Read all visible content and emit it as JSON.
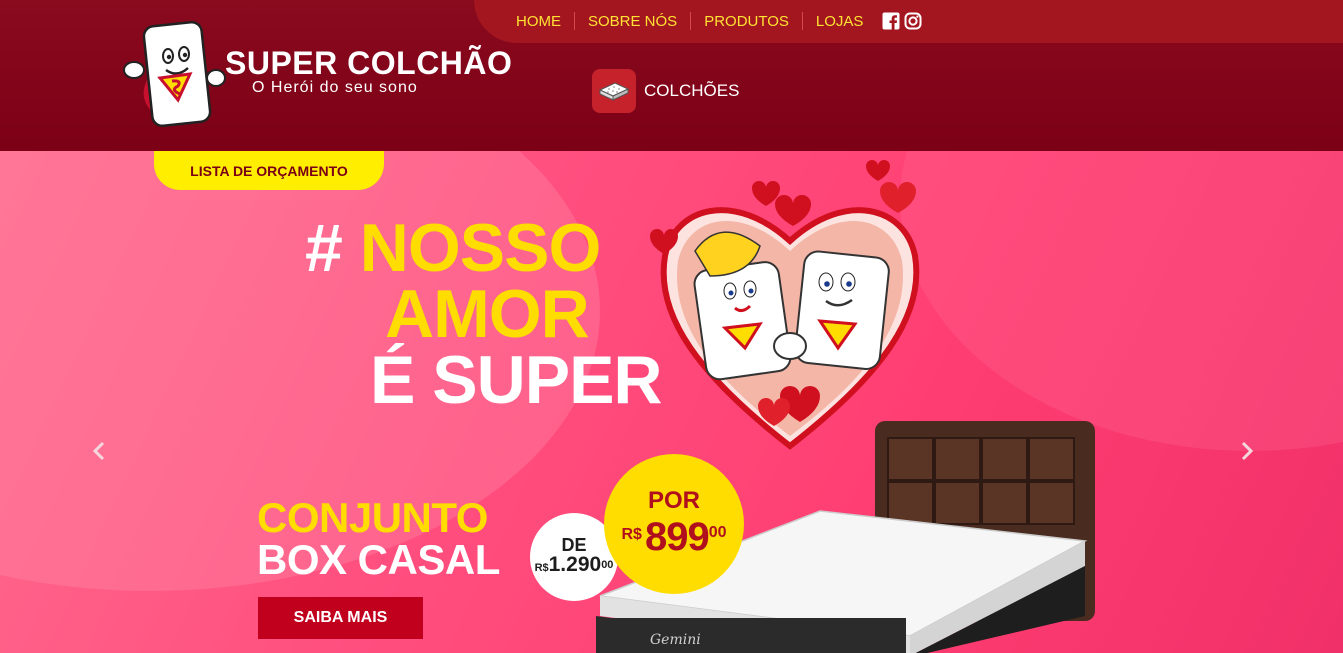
{
  "brand": {
    "name": "SUPER COLCHÃO",
    "tagline": "O Herói do seu sono"
  },
  "nav": {
    "items": [
      "HOME",
      "SOBRE NÓS",
      "PRODUTOS",
      "LOJAS"
    ],
    "social": [
      "facebook-icon",
      "instagram-icon"
    ]
  },
  "categories": [
    {
      "label": "COLCHÕES",
      "icon": "mattress-icon"
    }
  ],
  "banner": {
    "budget_tab": "LISTA DE ORÇAMENTO",
    "headline": {
      "hash": "#",
      "line1": "NOSSO",
      "line2": "AMOR",
      "line3": "É SUPER"
    },
    "product_line1": "CONJUNTO",
    "product_line2": "BOX CASAL",
    "old_price": {
      "prefix": "DE",
      "currency": "R$",
      "value": "1.290",
      "cents": "00"
    },
    "new_price": {
      "prefix": "POR",
      "currency": "R$",
      "value": "899",
      "cents": "00"
    },
    "cta": "SAIBA MAIS",
    "mattress_brand": "Gemini"
  },
  "colors": {
    "header_bg": "#7c0016",
    "nav_text": "#ffe233",
    "accent_yellow": "#ffdd00",
    "banner_pink": "#ff5080",
    "cta_red": "#c0001d"
  }
}
